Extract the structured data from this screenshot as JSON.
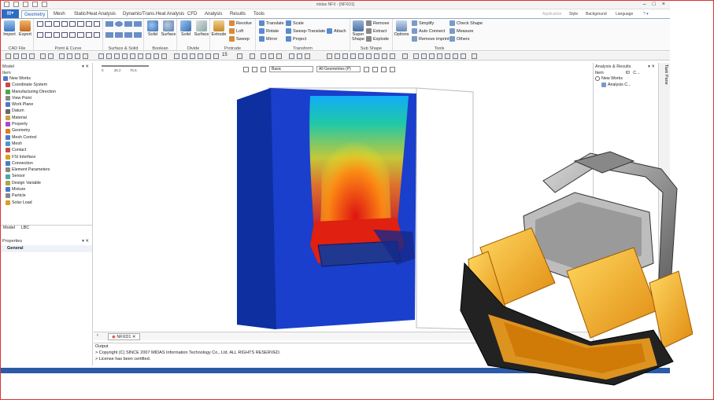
{
  "window": {
    "title": "midas NFX - [NFXD1]"
  },
  "ribbon_tabs": [
    "Geometry",
    "Mesh",
    "Static/Heat Analysis",
    "Dynamic/Trans.Heat Analysis",
    "CFD",
    "Analysis",
    "Results",
    "Tools"
  ],
  "ribbon_right": {
    "application": "Application",
    "style": "Style",
    "background": "Background",
    "language": "Language"
  },
  "groups": {
    "cad": {
      "label": "CAD File",
      "import": "Import",
      "export": "Export"
    },
    "point_curve": {
      "label": "Point & Curve"
    },
    "surface_solid": {
      "label": "Surface & Solid"
    },
    "boolean": {
      "label": "Boolean",
      "solid": "Solid",
      "surface": "Surface"
    },
    "divide": {
      "label": "Divide",
      "solid": "Solid",
      "surface": "Surface"
    },
    "protrude": {
      "label": "Protrude",
      "extrude": "Extrude",
      "revolve": "Revolve",
      "loft": "Loft",
      "sweep": "Sweep"
    },
    "transform": {
      "label": "Transform",
      "translate": "Translate",
      "rotate": "Rotate",
      "mirror": "Mirror",
      "scale": "Scale",
      "sweep_translate": "Sweep-Translate",
      "project": "Project",
      "attach": "Attach"
    },
    "subshape": {
      "label": "Sub Shape",
      "super_shape": "Super Shape",
      "remove": "Remove",
      "extract": "Extract",
      "explode": "Explode"
    },
    "tools": {
      "label": "Tools",
      "options": "Options",
      "simplify": "Simplify",
      "auto_connect": "Auto Connect",
      "remove_imprint": "Remove imprint",
      "check_shape": "Check Shape",
      "measure": "Measure",
      "others": "Others"
    }
  },
  "toolbar": {
    "step_value": "15"
  },
  "model_panel": {
    "title": "Model",
    "header": "Item",
    "items": [
      "New Works",
      "Coordinate System",
      "Manufacturing Direction",
      "View Point",
      "Work Plane",
      "Datum",
      "Material",
      "Property",
      "Geometry",
      "Mesh Control",
      "Mesh",
      "Contact",
      "FSI Interface",
      "Connection",
      "Element Parameters",
      "Sensor",
      "Design Variable",
      "Mixture",
      "Particle",
      "Solar Load"
    ],
    "tabs": [
      "Model",
      "LBC"
    ]
  },
  "properties_panel": {
    "title": "Properties",
    "section": "General"
  },
  "viewport": {
    "ruler": [
      "0",
      "38.2",
      "76.5"
    ],
    "display_mode": "Basic",
    "geometry_filter": "All Geometries (P)",
    "doc_tab": "NFXD1"
  },
  "output": {
    "title": "Output",
    "lines": [
      "> Copyright (C) SINCE 2007 MIDAS Information Technology Co., Ltd. ALL RIGHTS RESERVED.",
      "> License has been certified."
    ]
  },
  "analysis_panel": {
    "title": "Analysis & Results",
    "col_item": "Item",
    "col_id": "ID",
    "col_c": "C...",
    "items": [
      "New Works",
      "Analysis C..."
    ]
  },
  "task_pane": {
    "label": "Task Pane"
  },
  "colors": {
    "accent": "#2b6cc4",
    "status_bar": "#2b5aa8"
  }
}
